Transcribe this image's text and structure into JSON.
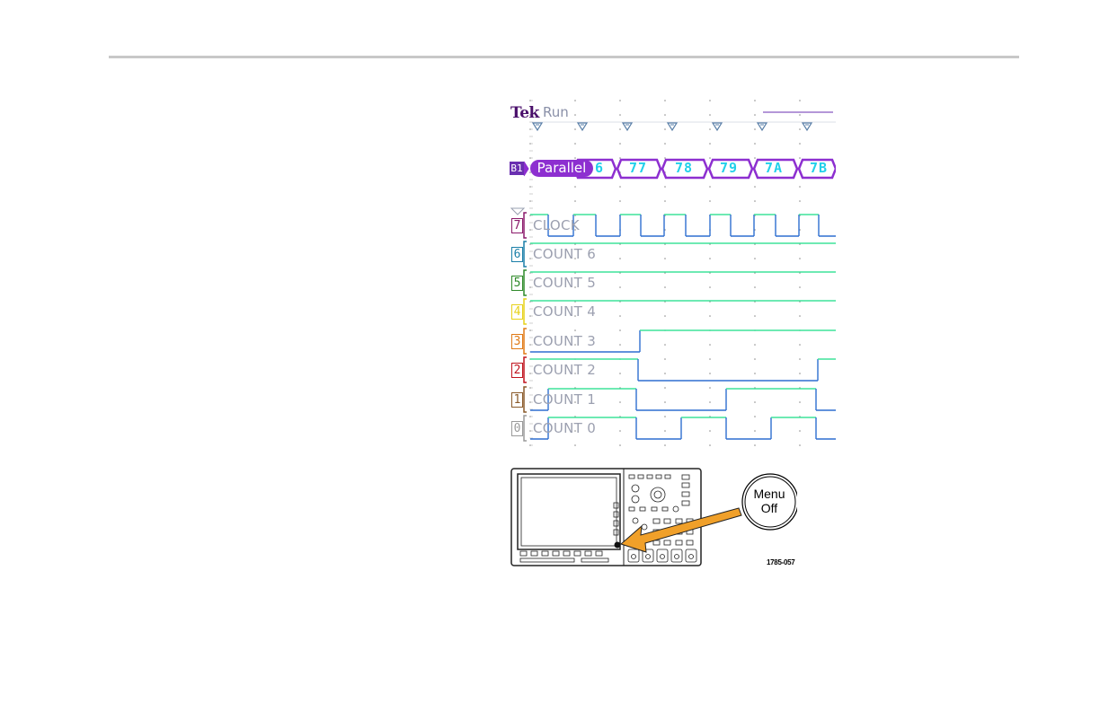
{
  "scope": {
    "brand": "Tek",
    "run_state": "Run",
    "bus": {
      "badge": "B1",
      "type_label": "Parallel",
      "values": [
        "6",
        "77",
        "78",
        "79",
        "7A",
        "7B"
      ]
    },
    "channels": [
      {
        "num": "7",
        "label": "CLOCK",
        "color": "#8b1a6b"
      },
      {
        "num": "6",
        "label": "COUNT 6",
        "color": "#1a7fa8"
      },
      {
        "num": "5",
        "label": "COUNT 5",
        "color": "#2f8a2a"
      },
      {
        "num": "4",
        "label": "COUNT 4",
        "color": "#e7d21a"
      },
      {
        "num": "3",
        "label": "COUNT 3",
        "color": "#e07a16"
      },
      {
        "num": "2",
        "label": "COUNT 2",
        "color": "#c0141e"
      },
      {
        "num": "1",
        "label": "COUNT 1",
        "color": "#8a5a2a"
      },
      {
        "num": "0",
        "label": "COUNT 0",
        "color": "#9a9a9a"
      }
    ],
    "colors": {
      "high": "#3ee39a",
      "low": "#2e6fd0",
      "bus": "#8d2fd0",
      "bus_text": "#22d0ea",
      "grid": "#8a8a8a"
    }
  },
  "diagram": {
    "button_line1": "Menu",
    "button_line2": "Off",
    "figure_id": "1785-057",
    "arrow_color": "#f0a02a"
  }
}
